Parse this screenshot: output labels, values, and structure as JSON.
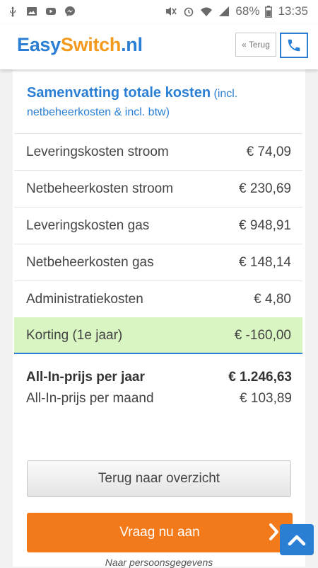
{
  "status_bar": {
    "battery": "68%",
    "time": "13:35",
    "icons": [
      "usb-icon",
      "image-icon",
      "youtube-icon",
      "messenger-icon",
      "mute-icon",
      "alarm-icon",
      "wifi-icon",
      "signal-icon",
      "battery-icon"
    ]
  },
  "header": {
    "logo_part1": "Easy",
    "logo_part2": "Switch",
    "logo_part3": ".nl",
    "back_label": "« Terug",
    "phone_icon": "phone-icon"
  },
  "summary": {
    "title": "Samenvatting totale kosten",
    "title_note": "(incl. netbeheerkosten & incl. btw)",
    "rows": [
      {
        "label": "Leveringskosten stroom",
        "value": "€ 74,09"
      },
      {
        "label": "Netbeheerkosten stroom",
        "value": "€ 230,69"
      },
      {
        "label": "Leveringskosten gas",
        "value": "€ 948,91"
      },
      {
        "label": "Netbeheerkosten gas",
        "value": "€ 148,14"
      },
      {
        "label": "Administratiekosten",
        "value": "€ 4,80"
      }
    ],
    "discount": {
      "label": "Korting (1e jaar)",
      "value": "€ -160,00"
    },
    "total_year": {
      "label": "All-In-prijs per jaar",
      "value": "€ 1.246,63"
    },
    "total_month": {
      "label": "All-In-prijs per maand",
      "value": "€ 103,89"
    }
  },
  "actions": {
    "back_overview": "Terug naar overzicht",
    "apply": "Vraag nu aan",
    "next_step": "Naar persoonsgegevens"
  },
  "colors": {
    "brand_blue": "#2a7fd4",
    "brand_orange": "#f39a1e",
    "button_orange": "#f27a1a",
    "discount_green": "#d8f5c2"
  }
}
